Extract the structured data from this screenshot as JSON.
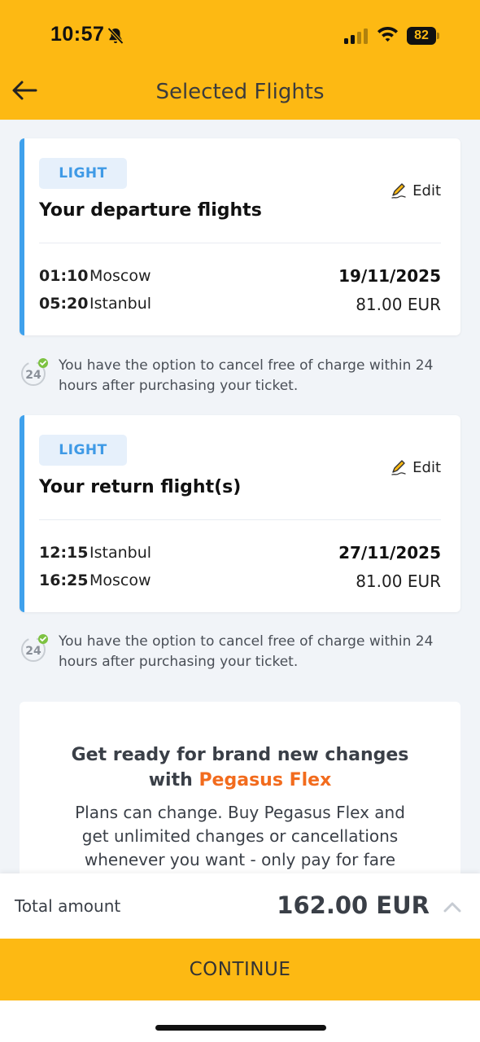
{
  "status_bar": {
    "time": "10:57",
    "battery": "82"
  },
  "header": {
    "title": "Selected Flights"
  },
  "departure": {
    "fare": "LIGHT",
    "edit_label": "Edit",
    "title": "Your departure flights",
    "legs": [
      {
        "time": "01:10",
        "city": "Moscow"
      },
      {
        "time": "05:20",
        "city": "Istanbul"
      }
    ],
    "date": "19/11/2025",
    "price": "81.00 EUR"
  },
  "departure_note": {
    "badge": "24",
    "text": "You have the option to cancel free of charge within 24 hours after purchasing your ticket."
  },
  "return": {
    "fare": "LIGHT",
    "edit_label": "Edit",
    "title": "Your return flight(s)",
    "legs": [
      {
        "time": "12:15",
        "city": "Istanbul"
      },
      {
        "time": "16:25",
        "city": "Moscow"
      }
    ],
    "date": "27/11/2025",
    "price": "81.00 EUR"
  },
  "return_note": {
    "badge": "24",
    "text": "You have the option to cancel free of charge within 24 hours after purchasing your ticket."
  },
  "flex_promo": {
    "title_line1": "Get ready for brand new changes",
    "title_with": "with",
    "brand": "Pegasus Flex",
    "description": "Plans can change. Buy Pegasus Flex and get unlimited changes or cancellations whenever you want - only pay for fare"
  },
  "footer": {
    "total_label": "Total amount",
    "total_value": "162.00 EUR",
    "continue_label": "CONTINUE"
  },
  "colors": {
    "brand_yellow": "#fdb913",
    "accent_blue": "#3fa1ec",
    "flex_orange": "#f26b1d",
    "check_green": "#7dc242"
  }
}
